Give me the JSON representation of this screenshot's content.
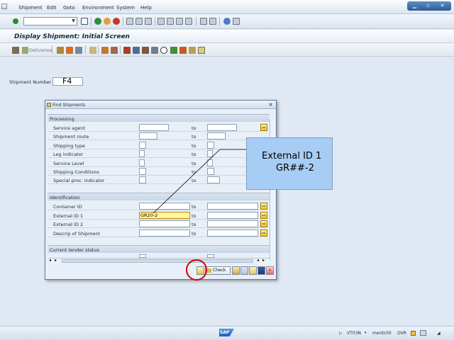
{
  "menu": {
    "items": [
      "Shipment",
      "Edit",
      "Goto",
      "Environment",
      "System",
      "Help"
    ]
  },
  "icons": {
    "std_toolbar": [
      "enter-icon",
      "save-icon",
      "back-icon",
      "exit-icon",
      "cancel-icon",
      "print-icon",
      "find-icon",
      "find-next-icon",
      "first-page-icon",
      "prev-page-icon",
      "next-page-icon",
      "last-page-icon",
      "new-session-icon",
      "shortcut-icon",
      "help-icon",
      "customize-icon"
    ],
    "app_toolbar": [
      "planning-icon",
      "deliveries-icon",
      "overview-icon",
      "transport-icon",
      "freight-icon",
      "doc-icon",
      "output-icon",
      "status-icon",
      "partners-icon",
      "dates-icon",
      "stages-icon",
      "handling-icon",
      "vehicle-icon",
      "texts-icon"
    ]
  },
  "toolbar": {
    "deliveries_label": "Deliveries"
  },
  "title": "Display Shipment: Initial Screen",
  "main": {
    "shipment_number_label": "Shipment Number",
    "shipment_number_value": "F4"
  },
  "dialog": {
    "title": "Find Shipments",
    "close": "×",
    "groups": [
      "Processing",
      "Identification",
      "Current tender status"
    ],
    "to_label": "to",
    "processing_rows": [
      {
        "label": "Service agent"
      },
      {
        "label": "Shipment route"
      },
      {
        "label": "Shipping type"
      },
      {
        "label": "Leg indicator"
      },
      {
        "label": "Service Level"
      },
      {
        "label": "Shipping Conditions"
      },
      {
        "label": "Special proc. indicator"
      }
    ],
    "identification_rows": [
      {
        "label": "Container ID",
        "value": ""
      },
      {
        "label": "External ID 1",
        "value": "GR20-2"
      },
      {
        "label": "External ID 2",
        "value": ""
      },
      {
        "label": "Descrip of Shipment",
        "value": ""
      }
    ],
    "check_label": "Check",
    "cancel_label": "✕"
  },
  "callout": {
    "line1": "External ID 1",
    "line2": "GR##-2"
  },
  "status": {
    "sap_logo": "SAP",
    "transaction": "VT03N",
    "server": "merdc00",
    "mode": "OVR"
  },
  "colors": {
    "highlight_circle": "#d20000",
    "callout_bg": "#a8cdf5",
    "active_input": "#fff59a"
  }
}
